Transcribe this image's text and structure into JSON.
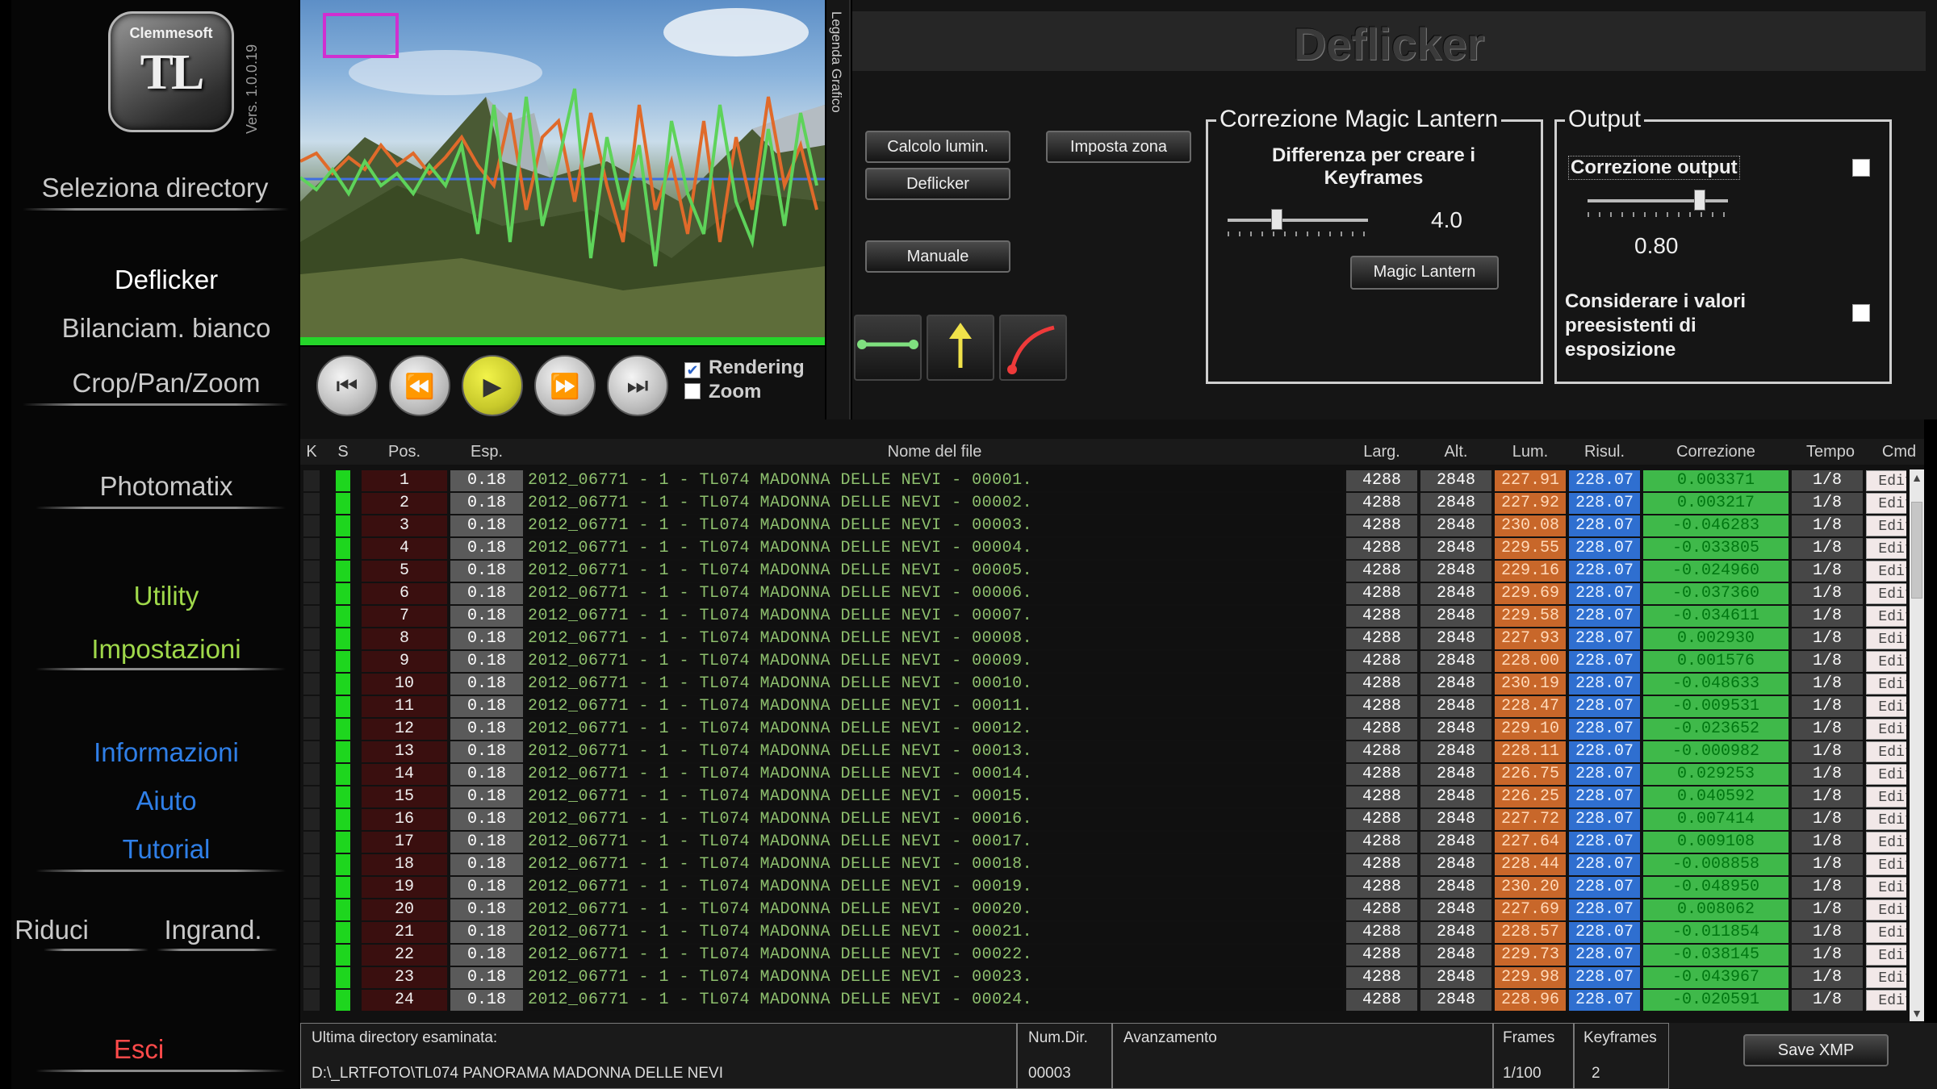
{
  "sidebar": {
    "brand": "Clemmesoft",
    "logo_mark": "TL",
    "version": "Vers. 1.0.0.19",
    "items": [
      {
        "label": "Seleziona directory"
      },
      {
        "label": "Deflicker"
      },
      {
        "label": "Bilanciam. bianco"
      },
      {
        "label": "Crop/Pan/Zoom"
      },
      {
        "label": "Photomatix"
      },
      {
        "label": "Utility"
      },
      {
        "label": "Impostazioni"
      },
      {
        "label": "Informazioni"
      },
      {
        "label": "Aiuto"
      },
      {
        "label": "Tutorial"
      },
      {
        "label": "Riduci"
      },
      {
        "label": "Ingrand."
      },
      {
        "label": "Esci"
      }
    ]
  },
  "preview": {
    "legend_tab": "Legenda Grafico"
  },
  "transport": {
    "rendering_label": "Rendering",
    "rendering_checked": true,
    "zoom_label": "Zoom",
    "zoom_checked": false,
    "buttons": [
      "first-icon",
      "rewind-icon",
      "play-icon",
      "fast-forward-icon",
      "last-icon"
    ]
  },
  "panel": {
    "title": "Deflicker",
    "buttons": {
      "calcolo": "Calcolo lumin.",
      "deflicker": "Deflicker",
      "manuale": "Manuale",
      "imposta_zona": "Imposta zona",
      "magic_lantern": "Magic Lantern"
    },
    "tools": [
      "line-tool-icon",
      "arrow-up-tool-icon",
      "curve-tool-icon"
    ],
    "magic": {
      "title": "Correzione Magic Lantern",
      "label": "Differenza per creare i Keyframes",
      "value": "4.0",
      "slider_fraction": 0.35
    },
    "output": {
      "title": "Output",
      "corr_label": "Correzione output",
      "corr_checked": false,
      "value": "0.80",
      "slider_fraction": 0.8,
      "considerare_label": "Considerare i valori preesistenti di esposizione",
      "considerare_checked": false
    }
  },
  "table": {
    "headers": [
      "K",
      "S",
      "Pos.",
      "Esp.",
      "Nome del file",
      "Larg.",
      "Alt.",
      "Lum.",
      "Risul.",
      "Correzione",
      "Tempo esp",
      "Cmd"
    ],
    "rows": [
      {
        "pos": "1",
        "esp": "0.18",
        "nome": "2012_06771 - 1 - TL074 MADONNA DELLE NEVI - 00001.",
        "larg": "4288",
        "alt": "2848",
        "lum": "227.91",
        "risul": "228.07",
        "corr": "0.003371",
        "tempo": "1/8",
        "cmd": "Edit"
      },
      {
        "pos": "2",
        "esp": "0.18",
        "nome": "2012_06771 - 1 - TL074 MADONNA DELLE NEVI - 00002.",
        "larg": "4288",
        "alt": "2848",
        "lum": "227.92",
        "risul": "228.07",
        "corr": "0.003217",
        "tempo": "1/8",
        "cmd": "Edit"
      },
      {
        "pos": "3",
        "esp": "0.18",
        "nome": "2012_06771 - 1 - TL074 MADONNA DELLE NEVI - 00003.",
        "larg": "4288",
        "alt": "2848",
        "lum": "230.08",
        "risul": "228.07",
        "corr": "-0.046283",
        "tempo": "1/8",
        "cmd": "Edit"
      },
      {
        "pos": "4",
        "esp": "0.18",
        "nome": "2012_06771 - 1 - TL074 MADONNA DELLE NEVI - 00004.",
        "larg": "4288",
        "alt": "2848",
        "lum": "229.55",
        "risul": "228.07",
        "corr": "-0.033805",
        "tempo": "1/8",
        "cmd": "Edit"
      },
      {
        "pos": "5",
        "esp": "0.18",
        "nome": "2012_06771 - 1 - TL074 MADONNA DELLE NEVI - 00005.",
        "larg": "4288",
        "alt": "2848",
        "lum": "229.16",
        "risul": "228.07",
        "corr": "-0.024960",
        "tempo": "1/8",
        "cmd": "Edit"
      },
      {
        "pos": "6",
        "esp": "0.18",
        "nome": "2012_06771 - 1 - TL074 MADONNA DELLE NEVI - 00006.",
        "larg": "4288",
        "alt": "2848",
        "lum": "229.69",
        "risul": "228.07",
        "corr": "-0.037360",
        "tempo": "1/8",
        "cmd": "Edit"
      },
      {
        "pos": "7",
        "esp": "0.18",
        "nome": "2012_06771 - 1 - TL074 MADONNA DELLE NEVI - 00007.",
        "larg": "4288",
        "alt": "2848",
        "lum": "229.58",
        "risul": "228.07",
        "corr": "-0.034611",
        "tempo": "1/8",
        "cmd": "Edit"
      },
      {
        "pos": "8",
        "esp": "0.18",
        "nome": "2012_06771 - 1 - TL074 MADONNA DELLE NEVI - 00008.",
        "larg": "4288",
        "alt": "2848",
        "lum": "227.93",
        "risul": "228.07",
        "corr": "0.002930",
        "tempo": "1/8",
        "cmd": "Edit"
      },
      {
        "pos": "9",
        "esp": "0.18",
        "nome": "2012_06771 - 1 - TL074 MADONNA DELLE NEVI - 00009.",
        "larg": "4288",
        "alt": "2848",
        "lum": "228.00",
        "risul": "228.07",
        "corr": "0.001576",
        "tempo": "1/8",
        "cmd": "Edit"
      },
      {
        "pos": "10",
        "esp": "0.18",
        "nome": "2012_06771 - 1 - TL074 MADONNA DELLE NEVI - 00010.",
        "larg": "4288",
        "alt": "2848",
        "lum": "230.19",
        "risul": "228.07",
        "corr": "-0.048633",
        "tempo": "1/8",
        "cmd": "Edit"
      },
      {
        "pos": "11",
        "esp": "0.18",
        "nome": "2012_06771 - 1 - TL074 MADONNA DELLE NEVI - 00011.",
        "larg": "4288",
        "alt": "2848",
        "lum": "228.47",
        "risul": "228.07",
        "corr": "-0.009531",
        "tempo": "1/8",
        "cmd": "Edit"
      },
      {
        "pos": "12",
        "esp": "0.18",
        "nome": "2012_06771 - 1 - TL074 MADONNA DELLE NEVI - 00012.",
        "larg": "4288",
        "alt": "2848",
        "lum": "229.10",
        "risul": "228.07",
        "corr": "-0.023652",
        "tempo": "1/8",
        "cmd": "Edit"
      },
      {
        "pos": "13",
        "esp": "0.18",
        "nome": "2012_06771 - 1 - TL074 MADONNA DELLE NEVI - 00013.",
        "larg": "4288",
        "alt": "2848",
        "lum": "228.11",
        "risul": "228.07",
        "corr": "-0.000982",
        "tempo": "1/8",
        "cmd": "Edit"
      },
      {
        "pos": "14",
        "esp": "0.18",
        "nome": "2012_06771 - 1 - TL074 MADONNA DELLE NEVI - 00014.",
        "larg": "4288",
        "alt": "2848",
        "lum": "226.75",
        "risul": "228.07",
        "corr": "0.029253",
        "tempo": "1/8",
        "cmd": "Edit"
      },
      {
        "pos": "15",
        "esp": "0.18",
        "nome": "2012_06771 - 1 - TL074 MADONNA DELLE NEVI - 00015.",
        "larg": "4288",
        "alt": "2848",
        "lum": "226.25",
        "risul": "228.07",
        "corr": "0.040592",
        "tempo": "1/8",
        "cmd": "Edit"
      },
      {
        "pos": "16",
        "esp": "0.18",
        "nome": "2012_06771 - 1 - TL074 MADONNA DELLE NEVI - 00016.",
        "larg": "4288",
        "alt": "2848",
        "lum": "227.72",
        "risul": "228.07",
        "corr": "0.007414",
        "tempo": "1/8",
        "cmd": "Edit"
      },
      {
        "pos": "17",
        "esp": "0.18",
        "nome": "2012_06771 - 1 - TL074 MADONNA DELLE NEVI - 00017.",
        "larg": "4288",
        "alt": "2848",
        "lum": "227.64",
        "risul": "228.07",
        "corr": "0.009108",
        "tempo": "1/8",
        "cmd": "Edit"
      },
      {
        "pos": "18",
        "esp": "0.18",
        "nome": "2012_06771 - 1 - TL074 MADONNA DELLE NEVI - 00018.",
        "larg": "4288",
        "alt": "2848",
        "lum": "228.44",
        "risul": "228.07",
        "corr": "-0.008858",
        "tempo": "1/8",
        "cmd": "Edit"
      },
      {
        "pos": "19",
        "esp": "0.18",
        "nome": "2012_06771 - 1 - TL074 MADONNA DELLE NEVI - 00019.",
        "larg": "4288",
        "alt": "2848",
        "lum": "230.20",
        "risul": "228.07",
        "corr": "-0.048950",
        "tempo": "1/8",
        "cmd": "Edit"
      },
      {
        "pos": "20",
        "esp": "0.18",
        "nome": "2012_06771 - 1 - TL074 MADONNA DELLE NEVI - 00020.",
        "larg": "4288",
        "alt": "2848",
        "lum": "227.69",
        "risul": "228.07",
        "corr": "0.008062",
        "tempo": "1/8",
        "cmd": "Edit"
      },
      {
        "pos": "21",
        "esp": "0.18",
        "nome": "2012_06771 - 1 - TL074 MADONNA DELLE NEVI - 00021.",
        "larg": "4288",
        "alt": "2848",
        "lum": "228.57",
        "risul": "228.07",
        "corr": "-0.011854",
        "tempo": "1/8",
        "cmd": "Edit"
      },
      {
        "pos": "22",
        "esp": "0.18",
        "nome": "2012_06771 - 1 - TL074 MADONNA DELLE NEVI - 00022.",
        "larg": "4288",
        "alt": "2848",
        "lum": "229.73",
        "risul": "228.07",
        "corr": "-0.038145",
        "tempo": "1/8",
        "cmd": "Edit"
      },
      {
        "pos": "23",
        "esp": "0.18",
        "nome": "2012_06771 - 1 - TL074 MADONNA DELLE NEVI - 00023.",
        "larg": "4288",
        "alt": "2848",
        "lum": "229.98",
        "risul": "228.07",
        "corr": "-0.043967",
        "tempo": "1/8",
        "cmd": "Edit"
      },
      {
        "pos": "24",
        "esp": "0.18",
        "nome": "2012_06771 - 1 - TL074 MADONNA DELLE NEVI - 00024.",
        "larg": "4288",
        "alt": "2848",
        "lum": "228.96",
        "risul": "228.07",
        "corr": "-0.020591",
        "tempo": "1/8",
        "cmd": "Edit"
      }
    ]
  },
  "status": {
    "ultima_label": "Ultima directory esaminata:",
    "ultima_value": "D:\\_LRTFOTO\\TL074 PANORAMA MADONNA DELLE NEVI",
    "numdir_label": "Num.Dir.",
    "numdir_value": "00003",
    "avanzamento_label": "Avanzamento",
    "frames_label": "Frames",
    "frames_value": "1/100",
    "keyframes_label": "Keyframes",
    "keyframes_value": "2",
    "save_xmp": "Save XMP"
  },
  "colors": {
    "lum": "#c8672a",
    "risul": "#2f6fd0",
    "corr": "#3fb94a",
    "sidebar_green": "#9fd84a",
    "sidebar_blue": "#2f7fe8",
    "esci_red": "#ff4a4a"
  }
}
